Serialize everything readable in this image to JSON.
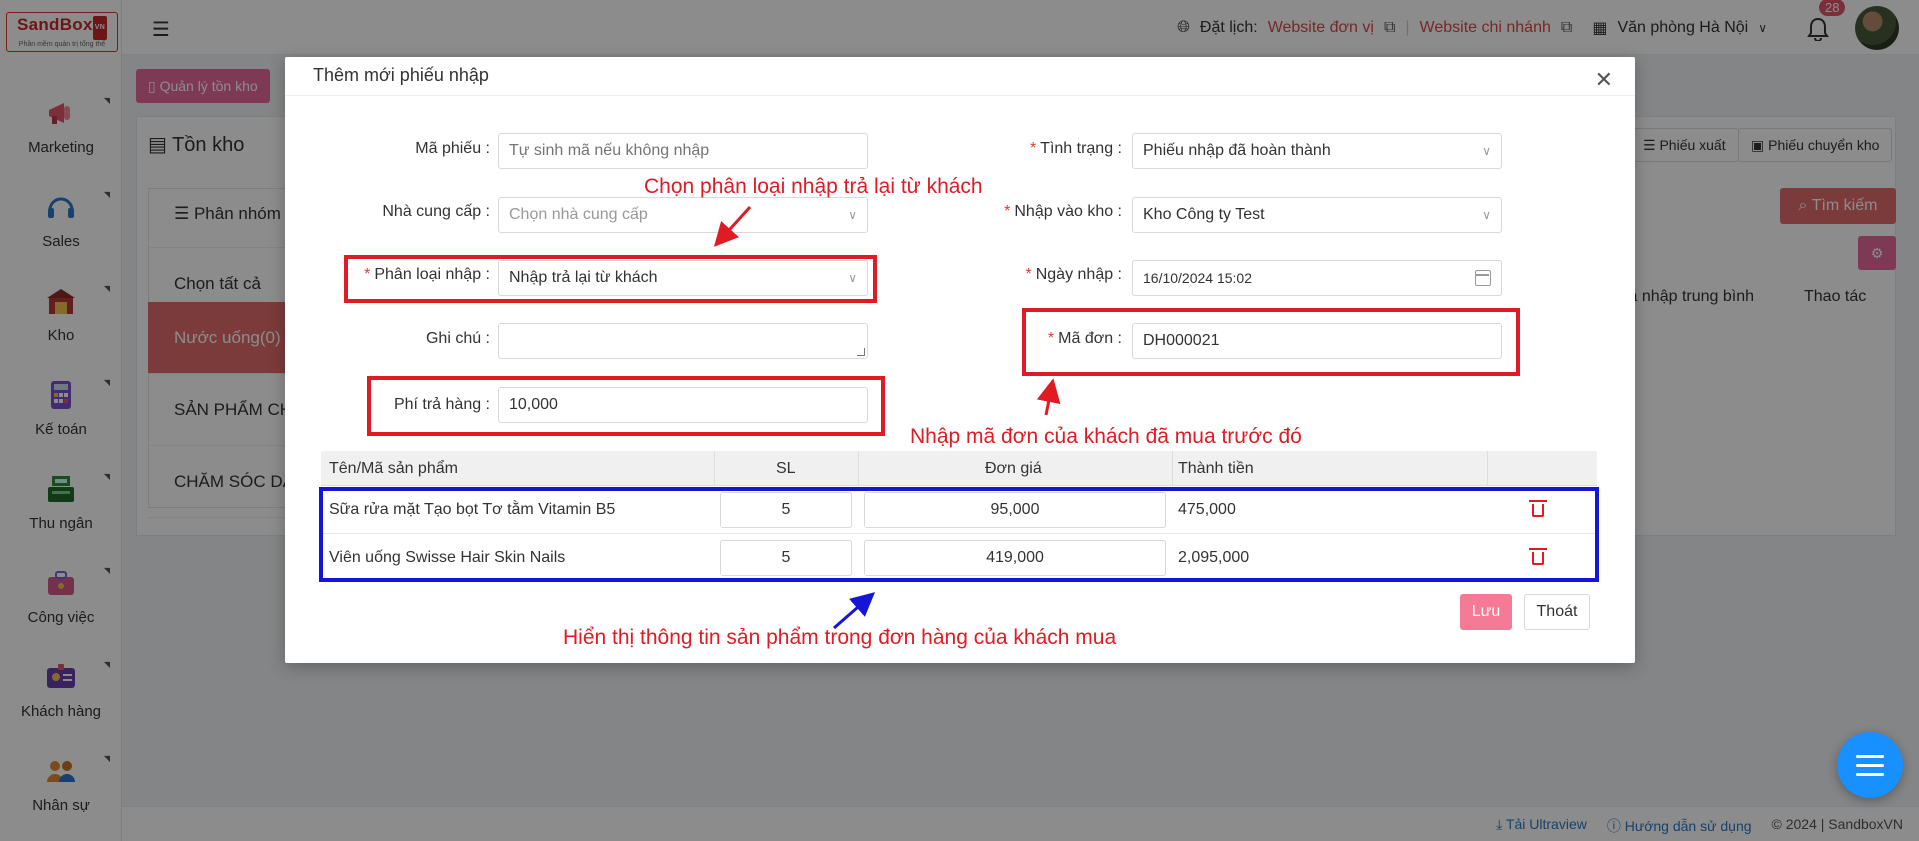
{
  "app": {
    "logo_main": "SandBox",
    "logo_tag": "VN",
    "logo_sub": "Phần mềm quản trị tổng thể"
  },
  "sidebar": {
    "items": [
      {
        "label": "Marketing",
        "icon": "megaphone-icon",
        "color": "#e2566b"
      },
      {
        "label": "Sales",
        "icon": "headset-icon",
        "color": "#2a78c6"
      },
      {
        "label": "Kho",
        "icon": "warehouse-icon",
        "color": "#b23a3a"
      },
      {
        "label": "Kế toán",
        "icon": "calculator-icon",
        "color": "#7b4fd0"
      },
      {
        "label": "Thu ngân",
        "icon": "cash-register-icon",
        "color": "#2e8b3a"
      },
      {
        "label": "Công việc",
        "icon": "briefcase-icon",
        "color": "#d65a8a"
      },
      {
        "label": "Khách hàng",
        "icon": "id-card-icon",
        "color": "#6a3fb0"
      },
      {
        "label": "Nhân sự",
        "icon": "people-icon",
        "color": "#e0893a"
      }
    ]
  },
  "topbar": {
    "schedule_label": "Đặt lịch:",
    "website_unit": "Website đơn vị",
    "website_branch": "Website chi nhánh",
    "office": "Văn phòng Hà Nội",
    "notification_count": "28"
  },
  "background": {
    "page_tab": "Quản lý tồn kho",
    "card_title": "Tồn kho",
    "group_header": "Phân nhóm",
    "groups": [
      "Chọn tất cả",
      "Nước uống(0)",
      "SẢN PHẨM CH",
      "CHĂM SÓC DA"
    ],
    "btn_export": "Phiếu xuất",
    "btn_transfer": "Phiếu chuyển kho",
    "btn_search": "Tìm kiếm",
    "col_avg_price": "iá nhập trung bình",
    "col_actions": "Thao tác"
  },
  "footer": {
    "ultraview": "Tải Ultraview",
    "guide": "Hướng dẫn sử dụng",
    "copyright": "© 2024 | SandboxVN"
  },
  "modal": {
    "title": "Thêm mới phiếu nhập",
    "fields": {
      "ma_phieu_label": "Mã phiếu",
      "ma_phieu_placeholder": "Tự sinh mã nếu không nhập",
      "nha_cung_cap_label": "Nhà cung cấp",
      "nha_cung_cap_placeholder": "Chọn nhà cung cấp",
      "phan_loai_label": "Phân loại nhập",
      "phan_loai_value": "Nhập trả lại từ khách",
      "ghi_chu_label": "Ghi chú",
      "phi_tra_hang_label": "Phí trả hàng",
      "phi_tra_hang_value": "10,000",
      "tinh_trang_label": "Tình trạng",
      "tinh_trang_value": "Phiếu nhập đã hoàn thành",
      "nhap_vao_kho_label": "Nhập vào kho",
      "nhap_vao_kho_value": "Kho Công ty Test",
      "ngay_nhap_label": "Ngày nhập",
      "ngay_nhap_value": "16/10/2024 15:02",
      "ma_don_label": "Mã đơn",
      "ma_don_value": "DH000021"
    },
    "table": {
      "headers": [
        "Tên/Mã sản phẩm",
        "SL",
        "Đơn giá",
        "Thành tiền"
      ],
      "rows": [
        {
          "name": "Sữa rửa mặt Tạo bọt Tơ tằm Vitamin B5",
          "qty": "5",
          "price": "95,000",
          "total": "475,000"
        },
        {
          "name": "Viên uống Swisse Hair Skin Nails",
          "qty": "5",
          "price": "419,000",
          "total": "2,095,000"
        }
      ]
    },
    "btn_save": "Lưu",
    "btn_exit": "Thoát"
  },
  "annotations": {
    "choose_type": "Chọn phân loại nhập trả lại từ khách",
    "enter_order": "Nhập mã đơn của khách đã mua trước đó",
    "show_products": "Hiển thị thông tin sản phẩm trong đơn hàng của khách mua"
  }
}
